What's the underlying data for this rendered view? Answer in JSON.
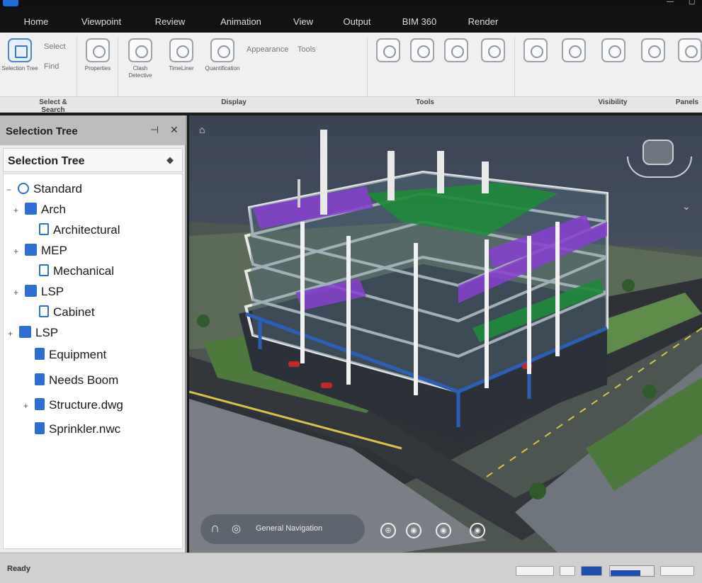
{
  "window": {
    "title": "",
    "accent_color": "#1e6fd9"
  },
  "ribbon": {
    "tabs": [
      {
        "label": "Home",
        "active": true
      },
      {
        "label": "Viewpoint",
        "active": false
      },
      {
        "label": "Review",
        "active": false
      },
      {
        "label": "Animation",
        "active": false
      },
      {
        "label": "View",
        "active": false
      },
      {
        "label": "Output",
        "active": false
      },
      {
        "label": "BIM 360",
        "active": false
      },
      {
        "label": "Render",
        "active": false
      }
    ],
    "buttons": [
      {
        "label": "Selection Tree",
        "icon": "selection-tree-icon"
      },
      {
        "label": "",
        "icon": "select-icon"
      },
      {
        "label": "Properties",
        "icon": "properties-icon"
      },
      {
        "label": "Clash Detective",
        "icon": "clash-icon"
      },
      {
        "label": "TimeLiner",
        "icon": "timeliner-icon"
      },
      {
        "label": "Quantification",
        "icon": "quantification-icon"
      },
      {
        "label": "",
        "icon": "tool-icon"
      },
      {
        "label": "",
        "icon": "tool-icon"
      },
      {
        "label": "",
        "icon": "tool-icon"
      },
      {
        "label": "",
        "icon": "tool-icon"
      },
      {
        "label": "",
        "icon": "tool-icon"
      },
      {
        "label": "",
        "icon": "tool-icon"
      },
      {
        "label": "",
        "icon": "tool-icon"
      },
      {
        "label": "",
        "icon": "tool-icon"
      },
      {
        "label": "",
        "icon": "tool-icon"
      }
    ],
    "small_items": [
      "Select",
      "Find",
      "Appearance",
      "Tools"
    ],
    "groups": [
      "Select & Search",
      "Display",
      "Tools",
      "Visibility",
      "Panels"
    ]
  },
  "panel": {
    "title": "Selection Tree",
    "pin_icon": "pin-icon",
    "close_icon": "close-icon",
    "subheader": "Selection Tree",
    "tree": [
      {
        "label": "Standard",
        "level": 0,
        "expander": "−",
        "icon": "cube"
      },
      {
        "label": "Arch",
        "level": 1,
        "expander": "+",
        "icon": "blue"
      },
      {
        "label": "Architectural",
        "level": 2,
        "expander": "",
        "icon": "doc"
      },
      {
        "label": "MEP",
        "level": 1,
        "expander": "+",
        "icon": "blue"
      },
      {
        "label": "Mechanical",
        "level": 2,
        "expander": "",
        "icon": "doc"
      },
      {
        "label": "LSP",
        "level": 1,
        "expander": "+",
        "icon": "blue"
      },
      {
        "label": "Cabinet",
        "level": 2,
        "expander": "",
        "icon": "doc"
      },
      {
        "label": "LSP",
        "level": 0,
        "expander": "+",
        "icon": "blue"
      },
      {
        "label": "Equipment",
        "level": 1,
        "expander": "",
        "icon": "doc-fill"
      },
      {
        "label": "Needs Boom",
        "level": 1,
        "expander": "",
        "icon": "doc-fill"
      },
      {
        "label": "Structure.dwg",
        "level": 1,
        "expander": "+",
        "icon": "doc-fill"
      },
      {
        "label": "Sprinkler.nwc",
        "level": 1,
        "expander": "",
        "icon": "doc-fill"
      }
    ]
  },
  "viewport": {
    "nav_text": "General Navigation",
    "nav_icons": [
      "navigation-wheel-icon",
      "orbit-icon"
    ],
    "circle_buttons": [
      "zoom-icon",
      "look-icon",
      "walk-icon",
      "pan-icon"
    ],
    "home_icon": "home-icon",
    "viewcube_icon": "viewcube-icon",
    "building_colors": {
      "structure": "#e7e7e7",
      "mep_purple": "#8a3fd1",
      "mep_green": "#1f8a3a",
      "pipe_blue": "#2a5fb8",
      "pipe_red": "#c0282a"
    }
  },
  "statusbar": {
    "text": "Ready",
    "progress": 0.7
  }
}
